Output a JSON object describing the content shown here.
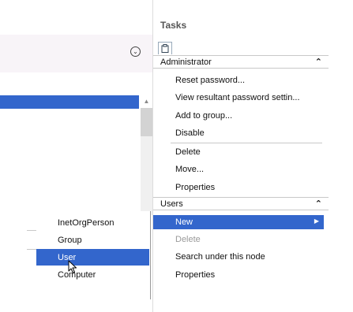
{
  "tasks": {
    "title": "Tasks",
    "sections": [
      {
        "name": "Administrator",
        "items": [
          {
            "label": "Reset password..."
          },
          {
            "label": "View resultant password settin..."
          },
          {
            "label": "Add to group..."
          },
          {
            "label": "Disable"
          },
          {
            "label": "Delete"
          },
          {
            "label": "Move..."
          },
          {
            "label": "Properties"
          }
        ]
      },
      {
        "name": "Users",
        "items": [
          {
            "label": "New",
            "selected": true
          },
          {
            "label": "Delete",
            "disabled": true
          },
          {
            "label": "Search under this node"
          },
          {
            "label": "Properties"
          }
        ]
      }
    ]
  },
  "submenu": {
    "items": [
      {
        "label": "InetOrgPerson"
      },
      {
        "label": "Group"
      },
      {
        "label": "User",
        "selected": true
      },
      {
        "label": "Computer"
      }
    ]
  },
  "icons": {
    "expand": "chevron-down-icon",
    "collapse": "chevron-up-icon",
    "tasks": "clipboard-icon",
    "cursor": "mouse-pointer-icon"
  },
  "colors": {
    "selection": "#3366cc",
    "disabled_text": "#9a9a9a"
  }
}
